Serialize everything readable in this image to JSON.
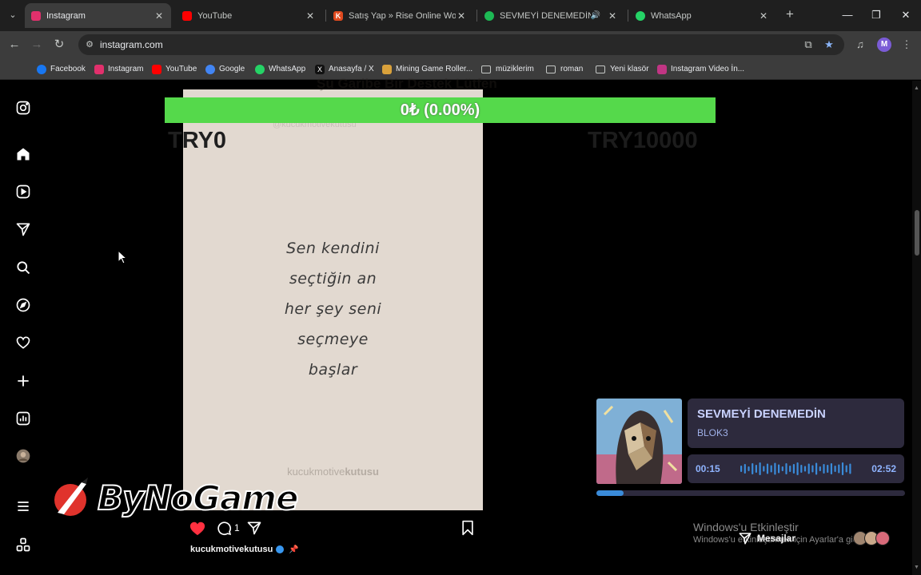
{
  "browser": {
    "tabs": [
      {
        "title": "Instagram",
        "active": true,
        "favicon_color": "#e1306c",
        "icon": "instagram-icon"
      },
      {
        "title": "YouTube",
        "active": false,
        "favicon_color": "#ff0000",
        "icon": "youtube-icon"
      },
      {
        "title": "Satış Yap » Rise Online World M",
        "active": false,
        "favicon_color": "#e04a1f",
        "icon": "k-icon"
      },
      {
        "title": "SEVMEYİ DENEMEDİN • BL",
        "active": false,
        "favicon_color": "#1db954",
        "icon": "spotify-icon",
        "audio": true
      },
      {
        "title": "WhatsApp",
        "active": false,
        "favicon_color": "#25d366",
        "icon": "whatsapp-icon"
      }
    ],
    "url": "instagram.com",
    "profile_initial": "M",
    "bookmarks": [
      {
        "label": "Facebook",
        "type": "site",
        "color": "#1877f2"
      },
      {
        "label": "Instagram",
        "type": "site",
        "color": "#e1306c"
      },
      {
        "label": "YouTube",
        "type": "site",
        "color": "#ff0000"
      },
      {
        "label": "Google",
        "type": "site",
        "color": "#4285f4"
      },
      {
        "label": "WhatsApp",
        "type": "site",
        "color": "#25d366"
      },
      {
        "label": "Anasayfa / X",
        "type": "site",
        "color": "#000000"
      },
      {
        "label": "Mining Game Roller...",
        "type": "site",
        "color": "#d9a13b"
      },
      {
        "label": "müziklerim",
        "type": "folder"
      },
      {
        "label": "roman",
        "type": "folder"
      },
      {
        "label": "Yeni klasör",
        "type": "folder"
      },
      {
        "label": "Instagram Video İn...",
        "type": "site",
        "color": "#c13584"
      }
    ]
  },
  "instagram": {
    "rail_icons": [
      "instagram-logo-icon",
      "home-icon",
      "reels-icon",
      "messages-icon",
      "search-icon",
      "explore-icon",
      "notifications-icon",
      "create-icon",
      "dashboard-icon",
      "profile-avatar",
      "more-menu-icon",
      "threads-icon"
    ],
    "post": {
      "quote_lines": [
        "Sen kendini",
        "seçtiğin an",
        "her şey seni",
        "seçmeye",
        "başlar"
      ],
      "watermark_light": "kucukmotive",
      "watermark_bold": "kutusu",
      "faint_title": "Şu Garibe Bir Destek Lütfen",
      "faint_handle": "@kucukmotivekutusu",
      "comment_count": "1",
      "author": "kucukmotivekutusu"
    }
  },
  "overlay": {
    "donation_goal": {
      "label": "0₺ (0.00%)",
      "progress": 0.0,
      "min_label": "TRY0",
      "max_label": "TRY10000",
      "bar_color": "#55d94b"
    },
    "brand": {
      "name": "ByNoGame"
    },
    "now_playing": {
      "title": "SEVMEYİ DENEMEDİN",
      "artist": "BLOK3",
      "current_time": "00:15",
      "duration": "02:52",
      "progress": 0.087
    },
    "windows_activation": {
      "line1": "Windows'u Etkinleştir",
      "line2": "Windows'u etkinleştirmek için Ayarlar'a gidin."
    },
    "messages_label": "Mesajlar"
  }
}
